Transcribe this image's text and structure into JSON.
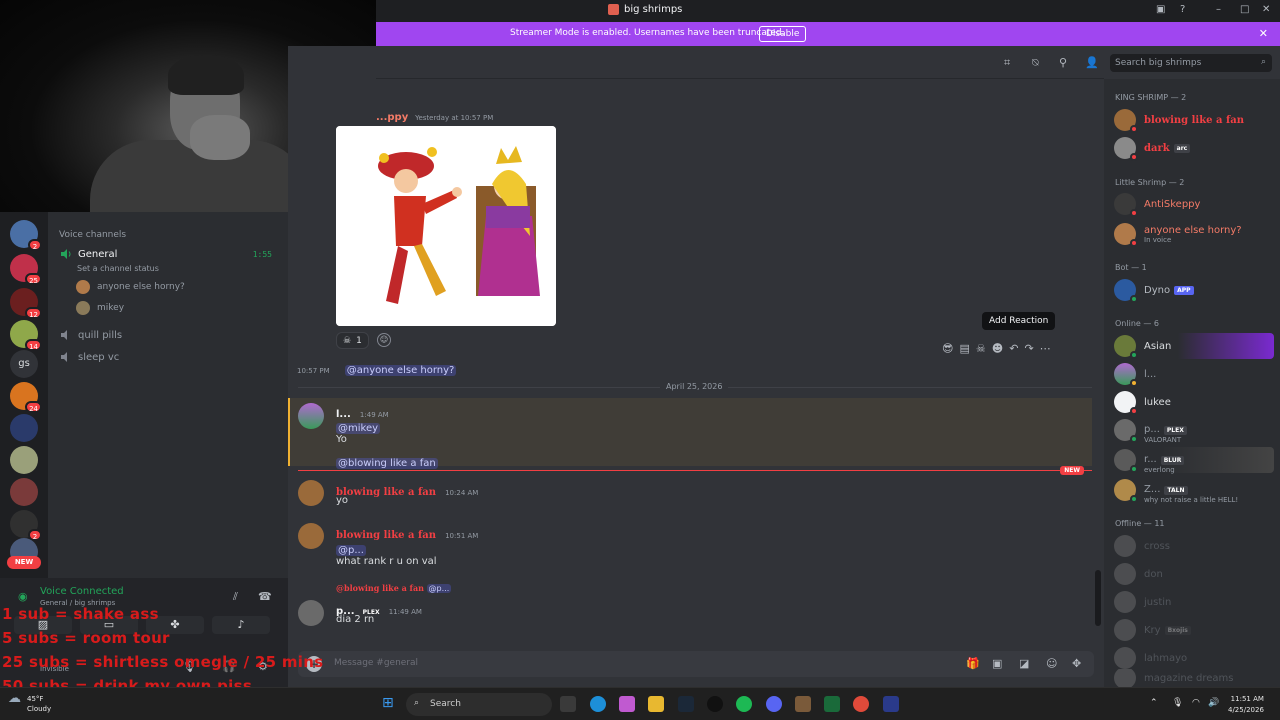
{
  "window": {
    "title": "big shrimps"
  },
  "banner": {
    "text": "Streamer Mode is enabled. Usernames have been truncated.",
    "disable_label": "Disable"
  },
  "server_badges": [
    "2",
    "25",
    "12",
    "14",
    "24",
    "2"
  ],
  "server_text_icon": "gs",
  "new_pill": "NEW",
  "channels": {
    "category": "Voice channels",
    "general": {
      "name": "General",
      "timer": "1:55",
      "status": "Set a channel status"
    },
    "voice_users": [
      "anyone else horny?",
      "mikey"
    ],
    "others": [
      "quill pills",
      "sleep vc"
    ]
  },
  "voice_panel": {
    "title": "Voice Connected",
    "subtitle": "General / big shrimps",
    "user_status": "Invisible"
  },
  "overlay_lines": [
    "1 sub = shake ass",
    "5 subs = room tour",
    "25 subs = shirtless omegle / 25 mins",
    "50 subs = drink my own piss"
  ],
  "header": {
    "search_placeholder": "Search big shrimps"
  },
  "messages": {
    "gif_author": "...ppy",
    "gif_time": "Yesterday at 10:57 PM",
    "reaction_count": "1",
    "tooltip": "Add Reaction",
    "followup_time": "10:57 PM",
    "followup_mention": "@anyone else horny?",
    "date_separator": "April 25, 2026",
    "m1": {
      "author": "l...",
      "time": "1:49 AM",
      "mention": "@mikey",
      "text": "Yo",
      "mention2": "@blowing like a fan"
    },
    "new_label": "NEW",
    "m2": {
      "author": "blowing like a fan",
      "time": "10:24 AM",
      "text": "yo"
    },
    "m3": {
      "author": "blowing like a fan",
      "time": "10:51 AM",
      "mention": "@p...",
      "text": "what rank r u on val"
    },
    "m4": {
      "reply_author": "@blowing like a fan",
      "reply_mention": "@p...",
      "author": "p...",
      "tag": "PLEX",
      "time": "11:49 AM",
      "text": "dia 2 rn"
    }
  },
  "composer": {
    "placeholder": "Message #general"
  },
  "members": {
    "groups": [
      "KING SHRIMP — 2",
      "Little Shrimp — 2",
      "Bot — 1",
      "Online — 6",
      "Offline — 11"
    ],
    "king": [
      {
        "name": "blowing like a fan"
      },
      {
        "name": "dark",
        "tag": "arc"
      }
    ],
    "little": [
      {
        "name": "AntiSkeppy"
      },
      {
        "name": "anyone else horny?",
        "sub": "In voice"
      }
    ],
    "bot": [
      {
        "name": "Dyno",
        "tag": "APP"
      }
    ],
    "online": [
      {
        "name": "Asian"
      },
      {
        "name": "l..."
      },
      {
        "name": "lukee"
      },
      {
        "name": "p...",
        "tag": "PLEX",
        "sub": "VALORANT"
      },
      {
        "name": "r...",
        "tag": "BLUR",
        "sub": "everlong"
      },
      {
        "name": "Z...",
        "tag": "TALN",
        "sub": "why not raise a little HELL!"
      }
    ],
    "offline": [
      {
        "name": "cross"
      },
      {
        "name": "don"
      },
      {
        "name": "justin"
      },
      {
        "name": "Kry",
        "tag": "Bxojis"
      },
      {
        "name": "lahmayo"
      },
      {
        "name": "magazine dreams"
      }
    ]
  },
  "taskbar": {
    "temp": "45°F",
    "weather": "Cloudy",
    "search": "Search",
    "time": "11:51 AM",
    "date": "4/25/2026"
  },
  "colors": {
    "accent": "#5865f2",
    "streamer_banner": "#a046f0",
    "king_role": "#f23f43",
    "little_role": "#f47b67",
    "online": "#23a55a",
    "overlay_text": "#d81b1b"
  }
}
